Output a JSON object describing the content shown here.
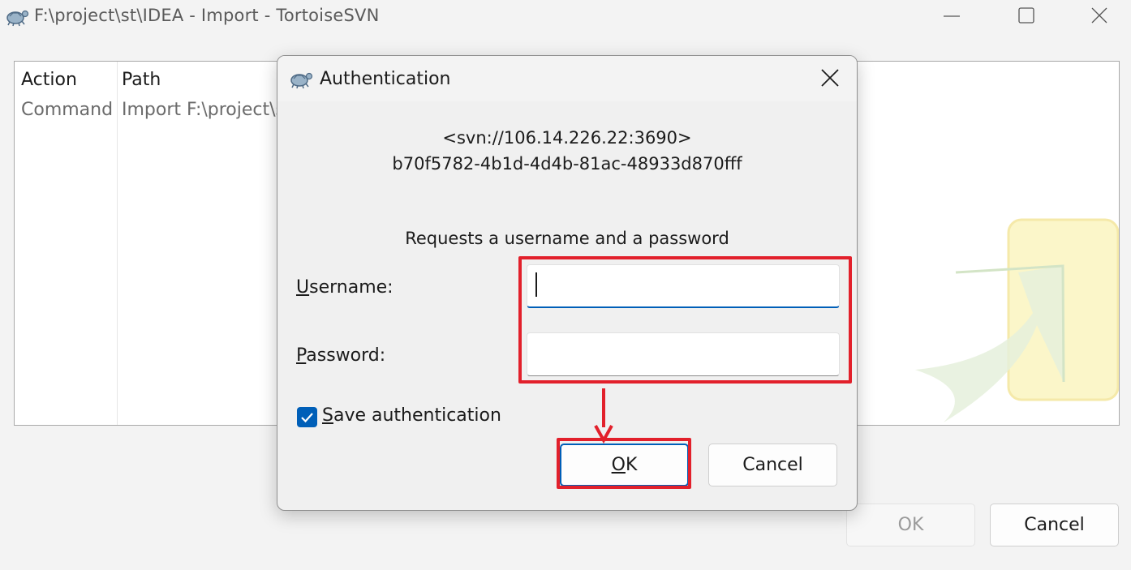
{
  "window": {
    "title": "F:\\project\\st\\IDEA - Import - TortoiseSVN",
    "icon": "tortoise-icon"
  },
  "log": {
    "columns": [
      "Action",
      "Path"
    ],
    "rows": [
      {
        "action": "Command",
        "path": "Import F:\\project\\s"
      }
    ]
  },
  "footer": {
    "ok_label": "OK",
    "cancel_label": "Cancel"
  },
  "dialog": {
    "title": "Authentication",
    "realm": "<svn://106.14.226.22:3690>",
    "uuid": "b70f5782-4b1d-4d4b-81ac-48933d870fff",
    "prompt": "Requests a username and a password",
    "username_label": {
      "mnemonic": "U",
      "rest": "sername:"
    },
    "password_label": {
      "mnemonic": "P",
      "rest": "assword:"
    },
    "username_value": "",
    "password_value": "",
    "save_auth": {
      "mnemonic": "S",
      "rest": "ave authentication",
      "checked": true
    },
    "ok_label": {
      "mnemonic": "O",
      "rest": "K"
    },
    "cancel_label": "Cancel"
  },
  "colors": {
    "accent": "#005fb8",
    "annotation_red": "#e2202b"
  }
}
